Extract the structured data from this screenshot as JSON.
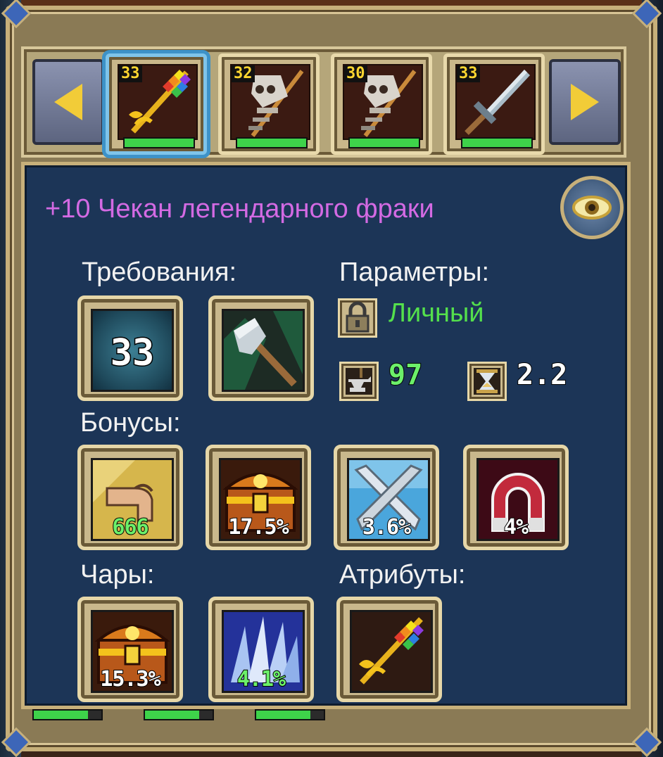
{
  "nav": {
    "prev_icon": "arrow-left-icon",
    "next_icon": "arrow-right-icon"
  },
  "item_strip": [
    {
      "level": "33",
      "icon": "rainbow-mace-icon",
      "health": 1.0,
      "selected": true
    },
    {
      "level": "32",
      "icon": "skeleton-axe-icon",
      "health": 1.0,
      "selected": false
    },
    {
      "level": "30",
      "icon": "skeleton-axe-icon",
      "health": 1.0,
      "selected": false
    },
    {
      "level": "33",
      "icon": "steel-sword-icon",
      "health": 1.0,
      "selected": false
    }
  ],
  "item": {
    "title": "+10 Чекан легендарного фраки",
    "inspect_icon": "eye-icon"
  },
  "sections": {
    "requirements": "Требования:",
    "parameters": "Параметры:",
    "bonuses": "Бонусы:",
    "enchants": "Чары:",
    "attributes": "Атрибуты:"
  },
  "requirements": {
    "level": "33",
    "weapon_class_icon": "axe-class-icon"
  },
  "parameters": {
    "binding": "Личный",
    "binding_icon": "lock-icon",
    "damage_icon": "anvil-icon",
    "damage": "97",
    "speed_icon": "hourglass-icon",
    "speed": "2.2"
  },
  "bonuses": [
    {
      "icon": "strength-arm-icon",
      "value": "666",
      "color": "#6cf06a"
    },
    {
      "icon": "treasure-chest-icon",
      "value": "17.5%",
      "color": "#ffffff"
    },
    {
      "icon": "crossed-swords-icon",
      "value": "3.6%",
      "color": "#ffffff"
    },
    {
      "icon": "magnet-icon",
      "value": "4%",
      "color": "#ffffff"
    }
  ],
  "enchants": [
    {
      "icon": "treasure-chest-icon",
      "value": "15.3%",
      "color": "#ffffff"
    },
    {
      "icon": "ice-spikes-icon",
      "value": "4.1%",
      "color": "#6cf06a"
    }
  ],
  "attributes": [
    {
      "icon": "rainbow-mace-icon"
    }
  ],
  "colors": {
    "title": "#d36ae3",
    "binding": "#54e04c",
    "level_badge": "#ffd630",
    "panel_bg": "#1c3557",
    "frame": "#c7b07a"
  }
}
